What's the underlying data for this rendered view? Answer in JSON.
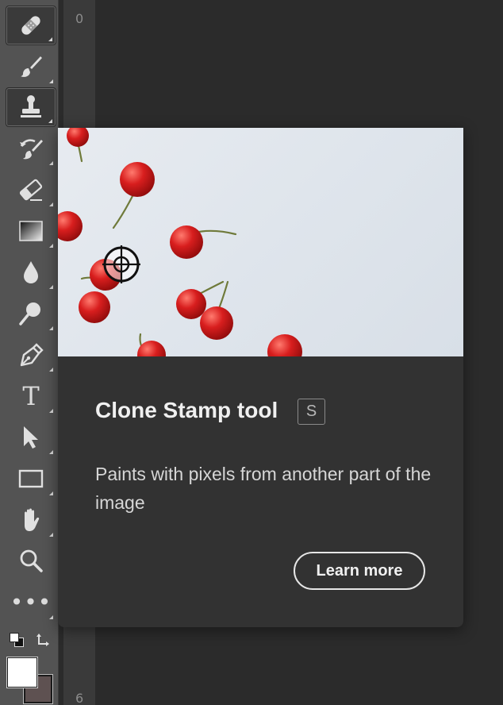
{
  "ruler": {
    "top_number": "0",
    "bottom_number": "6"
  },
  "toolbar": {
    "tools": [
      {
        "name": "healing-brush",
        "active": true
      },
      {
        "name": "brush",
        "active": false
      },
      {
        "name": "clone-stamp",
        "active": true
      },
      {
        "name": "history-brush",
        "active": false
      },
      {
        "name": "eraser",
        "active": false
      },
      {
        "name": "gradient",
        "active": false
      },
      {
        "name": "blur",
        "active": false
      },
      {
        "name": "dodge",
        "active": false
      },
      {
        "name": "pen",
        "active": false
      },
      {
        "name": "type",
        "active": false,
        "glyph": "T"
      },
      {
        "name": "path-selection",
        "active": false
      },
      {
        "name": "rectangle",
        "active": false
      },
      {
        "name": "hand",
        "active": false
      },
      {
        "name": "zoom",
        "active": false
      },
      {
        "name": "more-tools",
        "active": false,
        "glyph": "•••"
      }
    ],
    "colors": {
      "foreground": "#ffffff",
      "background": "#5e5151"
    }
  },
  "tooltip": {
    "title": "Clone Stamp tool",
    "shortcut": "S",
    "description": "Paints with pixels from another part of the image",
    "button_label": "Learn more"
  }
}
